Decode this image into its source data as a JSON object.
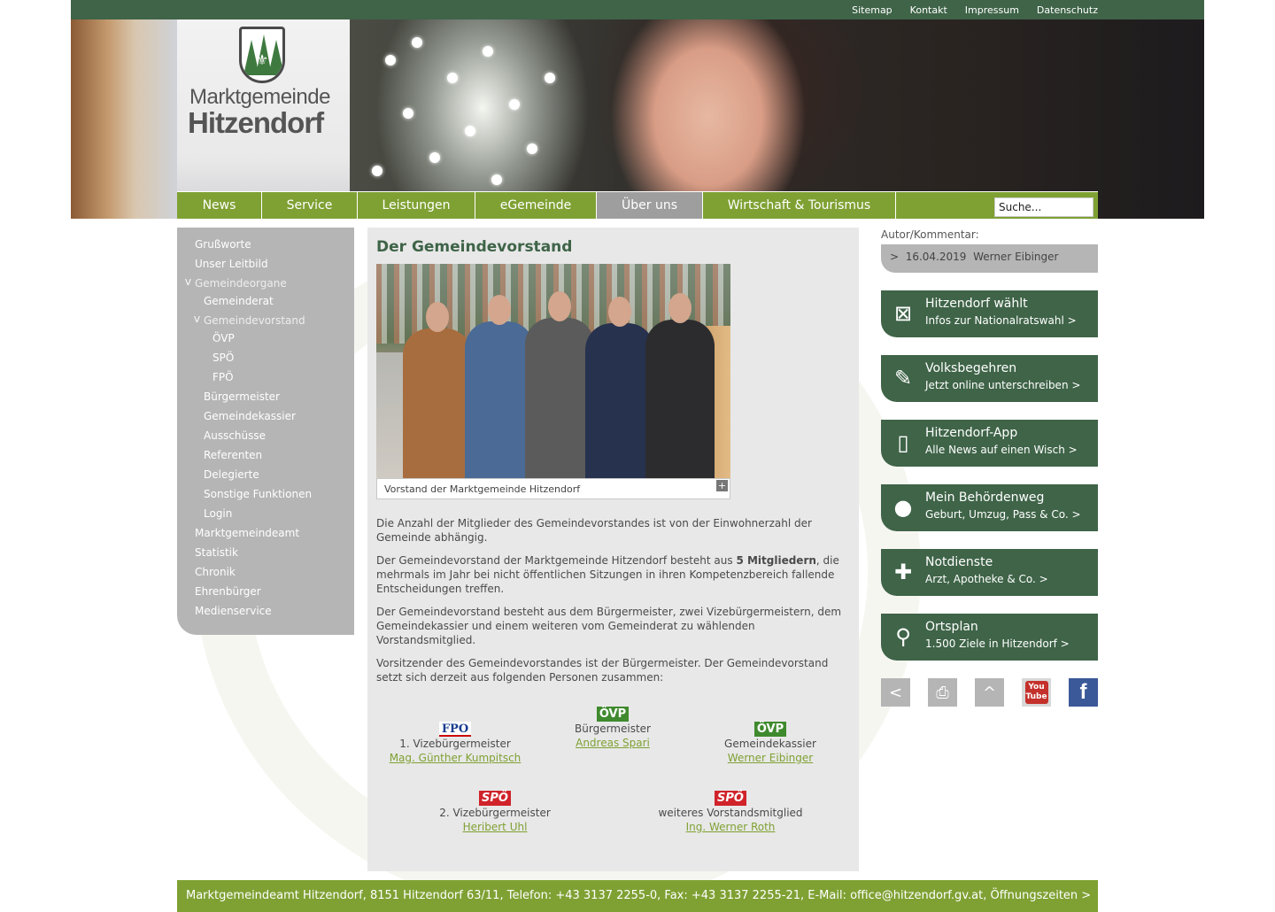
{
  "top_links": [
    "Sitemap",
    "Kontakt",
    "Impressum",
    "Datenschutz"
  ],
  "logo": {
    "line1": "Marktgemeinde",
    "line2": "Hitzendorf"
  },
  "nav": {
    "items": [
      {
        "label": "News",
        "active": false
      },
      {
        "label": "Service",
        "active": false
      },
      {
        "label": "Leistungen",
        "active": false
      },
      {
        "label": "eGemeinde",
        "active": false
      },
      {
        "label": "Über uns",
        "active": true
      },
      {
        "label": "Wirtschaft & Tourismus",
        "active": false
      }
    ],
    "search_placeholder": "Suche..."
  },
  "sidenav": [
    {
      "label": "Grußworte",
      "level": 0
    },
    {
      "label": "Unser Leitbild",
      "level": 0
    },
    {
      "label": "Gemeindeorgane",
      "level": 0,
      "open": true
    },
    {
      "label": "Gemeinderat",
      "level": 1
    },
    {
      "label": "Gemeindevorstand",
      "level": 1,
      "open": true
    },
    {
      "label": "ÖVP",
      "level": 2
    },
    {
      "label": "SPÖ",
      "level": 2
    },
    {
      "label": "FPÖ",
      "level": 2
    },
    {
      "label": "Bürgermeister",
      "level": 1
    },
    {
      "label": "Gemeindekassier",
      "level": 1
    },
    {
      "label": "Ausschüsse",
      "level": 1
    },
    {
      "label": "Referenten",
      "level": 1
    },
    {
      "label": "Delegierte",
      "level": 1
    },
    {
      "label": "Sonstige Funktionen",
      "level": 1
    },
    {
      "label": "Login",
      "level": 1
    },
    {
      "label": "Marktgemeindeamt",
      "level": 0
    },
    {
      "label": "Statistik",
      "level": 0
    },
    {
      "label": "Chronik",
      "level": 0
    },
    {
      "label": "Ehrenbürger",
      "level": 0
    },
    {
      "label": "Medienservice",
      "level": 0
    }
  ],
  "sidenav_open_marker": "V",
  "main": {
    "title": "Der Gemeindevorstand",
    "caption": "Vorstand der Marktgemeinde Hitzendorf",
    "expand": "+",
    "p1": "Die Anzahl der Mitglieder des Gemeindevorstandes ist von der Einwohnerzahl der Gemeinde abhängig.",
    "p2_a": "Der Gemeindevorstand der Marktgemeinde Hitzendorf besteht aus ",
    "p2_b": "5 Mitgliedern",
    "p2_c": ", die mehrmals im Jahr bei nicht öffentlichen Sitzungen in ihren Kompetenzbereich fallende Entscheidungen treffen.",
    "p3": "Der Gemeindevorstand besteht aus dem Bürgermeister, zwei Vizebürgermeistern, dem Gemeindekassier und einem weiteren vom Gemeinderat zu wählenden Vorstandsmitglied.",
    "p4": "Vorsitzender des Gemeindevorstandes ist der Bürgermeister. Der Gemeindevorstand setzt sich derzeit aus folgenden Personen zusammen:",
    "members": [
      {
        "party": "FPO",
        "role": "1. Vizebürgermeister",
        "name": "Mag. Günther Kumpitsch"
      },
      {
        "party": "ÖVP",
        "role": "Bürgermeister",
        "name": "Andreas Spari"
      },
      {
        "party": "ÖVP",
        "role": "Gemeindekassier",
        "name": "Werner Eibinger"
      },
      {
        "party": "SPÖ",
        "role": "2. Vizebürgermeister",
        "name": "Heribert Uhl"
      },
      {
        "party": "SPÖ",
        "role": "weiteres Vorstandsmitglied",
        "name": "Ing. Werner Roth"
      }
    ]
  },
  "autor": {
    "label": "Autor/Kommentar:",
    "marker": ">",
    "date": "16.04.2019",
    "name": "Werner Eibinger"
  },
  "tiles": [
    {
      "icon": "ballot-x-icon",
      "title": "Hitzendorf wählt",
      "sub": "Infos zur Nationalratswahl >"
    },
    {
      "icon": "pen-icon",
      "title": "Volksbegehren",
      "sub": "Jetzt online unterschreiben >"
    },
    {
      "icon": "phone-icon",
      "title": "Hitzendorf-App",
      "sub": "Alle News auf einen Wisch >"
    },
    {
      "icon": "official-icon",
      "title": "Mein Behördenweg",
      "sub": "Geburt, Umzug, Pass & Co. >"
    },
    {
      "icon": "first-aid-icon",
      "title": "Notdienste",
      "sub": "Arzt, Apotheke & Co. >"
    },
    {
      "icon": "map-pin-icon",
      "title": "Ortsplan",
      "sub": "1.500 Ziele in Hitzendorf >"
    }
  ],
  "social": {
    "youtube_top": "You",
    "youtube_bottom": "Tube",
    "facebook": "f"
  },
  "footer": "Marktgemeindeamt Hitzendorf, 8151 Hitzendorf 63/11, Telefon: +43 3137 2255-0, Fax: +43 3137 2255-21, E-Mail: office@hitzendorf.gv.at, Öffnungszeiten >",
  "colors": {
    "dark_green": "#3f6448",
    "light_green": "#7fa133",
    "grey": "#b5b5b5"
  }
}
